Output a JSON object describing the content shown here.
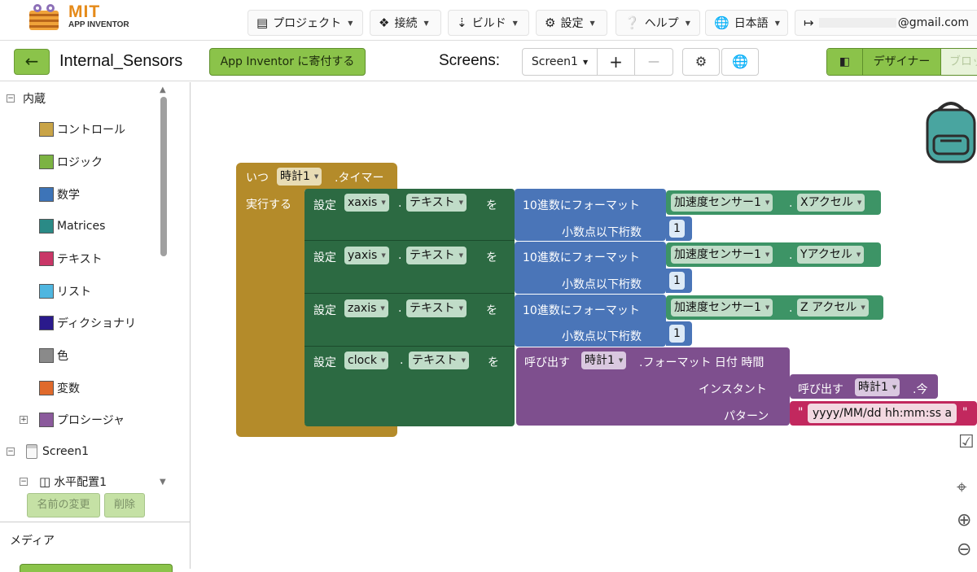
{
  "app": {
    "logo_mit": "MIT",
    "logo_sub": "APP INVENTOR",
    "menus": [
      {
        "icon": "folder-icon",
        "label": "プロジェクト"
      },
      {
        "icon": "connect-icon",
        "label": "接続"
      },
      {
        "icon": "build-icon",
        "label": "ビルド"
      },
      {
        "icon": "settings-icon",
        "label": "設定"
      },
      {
        "icon": "help-icon",
        "label": "ヘルプ"
      },
      {
        "icon": "globe-icon",
        "label": "日本語"
      }
    ],
    "account": "@gmail.com"
  },
  "toolbar": {
    "back_label": "←",
    "project_name": "Internal_Sensors",
    "donate_label": "App Inventor に寄付する",
    "screens_label": "Screens:",
    "screen_selected": "Screen1",
    "add_screen": "+",
    "remove_screen": "—",
    "designer_label": "デザイナー",
    "blocks_label": "ブロッ"
  },
  "palette": {
    "builtin_label": "内蔵",
    "categories": [
      {
        "label": "コントロール",
        "color": "#c9a447"
      },
      {
        "label": "ロジック",
        "color": "#7cb342"
      },
      {
        "label": "数学",
        "color": "#3d74b8"
      },
      {
        "label": "Matrices",
        "color": "#2a8a86"
      },
      {
        "label": "テキスト",
        "color": "#c93667"
      },
      {
        "label": "リスト",
        "color": "#4fb6e0"
      },
      {
        "label": "ディクショナリ",
        "color": "#2a1a8c"
      },
      {
        "label": "色",
        "color": "#8a8a8a"
      },
      {
        "label": "変数",
        "color": "#e06a2c"
      },
      {
        "label": "プロシージャ",
        "color": "#8b5a9c"
      }
    ],
    "screen_label": "Screen1",
    "arrangement_label": "水平配置1",
    "rename_label": "名前の変更",
    "delete_label": "削除",
    "media_label": "メディア"
  },
  "blocks": {
    "event": {
      "when": "いつ",
      "component": "時計1",
      "event_name": ".タイマー",
      "do": "実行する"
    },
    "set_label": "設定",
    "property": "テキスト",
    "to": "を",
    "format_label": "10進数にフォーマット",
    "decimals_label": "小数点以下桁数",
    "decimals_value": "1",
    "sensor": "加速度センサー1",
    "rows": [
      {
        "var": "xaxis",
        "axis": "Xアクセル"
      },
      {
        "var": "yaxis",
        "axis": "Yアクセル"
      },
      {
        "var": "zaxis",
        "axis": "Z アクセル"
      }
    ],
    "clock_row": {
      "var": "clock",
      "call": "呼び出す",
      "component": "時計1",
      "method": ".フォーマット 日付 時間",
      "instant_label": "インスタント",
      "now": ".今",
      "pattern_label": "パターン",
      "pattern_value": "yyyy/MM/dd hh:mm:ss a",
      "quote": "\""
    }
  }
}
